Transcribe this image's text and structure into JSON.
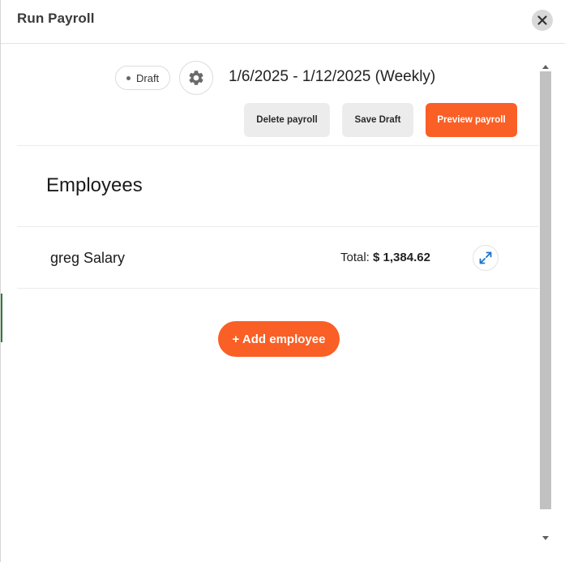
{
  "header": {
    "title": "Run Payroll"
  },
  "payroll": {
    "status": "Draft",
    "date_range": "1/6/2025 - 1/12/2025 (Weekly)"
  },
  "actions": {
    "delete_label": "Delete payroll",
    "save_label": "Save Draft",
    "preview_label": "Preview payroll"
  },
  "employees": {
    "section_title": "Employees",
    "rows": [
      {
        "name": "greg Salary",
        "total_label": "Total:",
        "total_value": "$ 1,384.62"
      }
    ],
    "add_label": "+ Add employee"
  },
  "icons": {
    "close": "close-icon",
    "gear": "gear-icon",
    "expand": "expand-icon"
  },
  "colors": {
    "accent": "#fa5f26",
    "secondary_button": "#ececec",
    "expand_icon": "#1a73c9"
  }
}
